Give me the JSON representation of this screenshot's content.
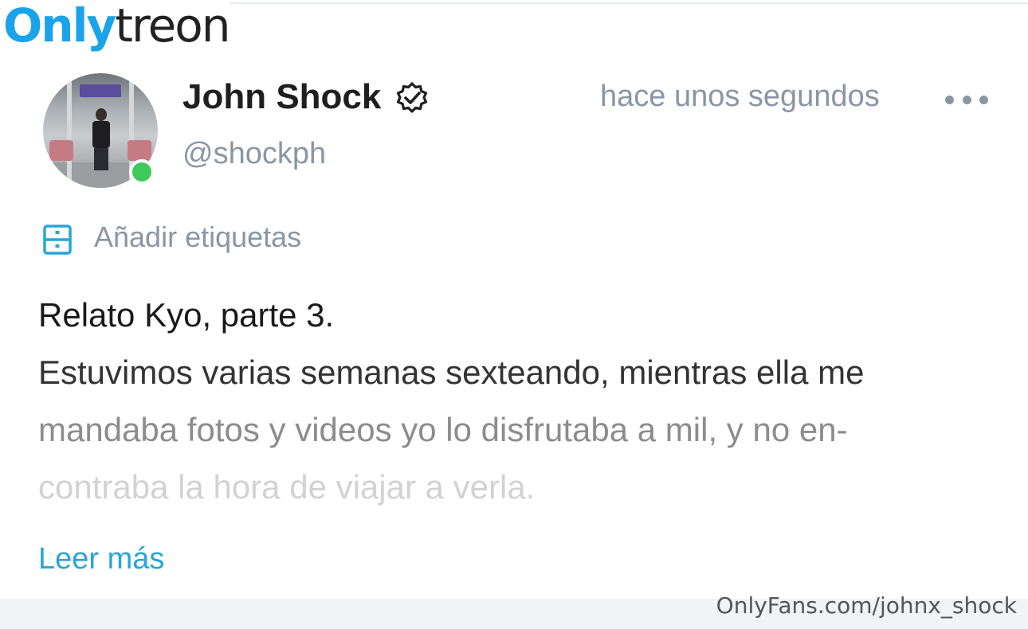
{
  "watermark": {
    "logo_part1": "Only",
    "logo_part2": "treon",
    "source": "OnlyFans.com/johnx_shock"
  },
  "post": {
    "author": {
      "name": "John Shock",
      "handle": "@shockph",
      "verified": true,
      "online": true
    },
    "timestamp": "hace unos segundos",
    "tags_label": "Añadir etiquetas",
    "title": "Relato Kyo, parte 3.",
    "body_lines": [
      "Estuvimos varias semanas sexteando, mientras ella me",
      "mandaba fotos y videos yo lo disfrutaba a mil, y no en-",
      "contraba la hora de viajar a verla."
    ],
    "read_more": "Leer más"
  },
  "colors": {
    "accent": "#27a6d6",
    "muted": "#8a96a3",
    "online": "#3ec95a",
    "logo_blue": "#1aa3e8"
  },
  "icons": {
    "verified": "verified-badge-icon",
    "more": "more-options-icon",
    "tags": "tag-drawer-icon"
  }
}
